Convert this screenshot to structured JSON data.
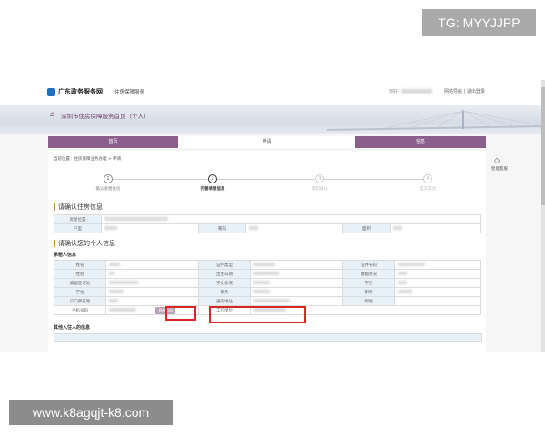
{
  "overlay": {
    "tg_label": "TG: MYYJJPP",
    "watermark_url": "www.k8agqjt-k8.com"
  },
  "portal": {
    "site_name": "广东政务服务网",
    "service_name": "住房保障服务",
    "user_prefix": "你好",
    "top_links": "网站导航 | 退出登录",
    "banner_title": "深圳市住房保障服务首页（个人）"
  },
  "nav": {
    "items": [
      {
        "label": "首页"
      },
      {
        "label": "申请"
      },
      {
        "label": "信息"
      }
    ]
  },
  "side": {
    "icon": "diamond-arrow-icon",
    "label": "智能客服"
  },
  "breadcrumb": "当前位置：住房保障业务办理 > 申请",
  "steps": [
    {
      "num": "1",
      "label": "确认承租住房"
    },
    {
      "num": "2",
      "label": "完善承租信息"
    },
    {
      "num": "3",
      "label": "资料确认"
    },
    {
      "num": "4",
      "label": "提交成功"
    }
  ],
  "housing_section": {
    "title": "请确认住房信息",
    "location_label": "房屋位置",
    "type_label": "户型",
    "area_label": "朝向",
    "size_label": "面积"
  },
  "personal_section": {
    "title": "请确认您的个人信息",
    "applicant_title": "承租人信息",
    "rows": [
      [
        "姓名",
        "",
        "证件类型",
        "",
        "证件号码",
        ""
      ],
      [
        "性别",
        "",
        "出生日期",
        "",
        "婚姻状况",
        ""
      ],
      [
        "婚姻登记地",
        "",
        "子女状况",
        "",
        "学历",
        ""
      ],
      [
        "学位",
        "",
        "职务",
        "",
        "职称",
        ""
      ],
      [
        "户口所在地",
        "",
        "通讯地址",
        "",
        "邮编",
        ""
      ]
    ],
    "phone_label": "手机号码",
    "modify_button": "修改号码",
    "employer_label": "工作单位"
  },
  "other_section": {
    "title": "其他入住人的信息"
  },
  "colors": {
    "nav_purple": "#8b5e8c",
    "highlight_red": "#d62828",
    "label_bg": "#e8f0f8"
  }
}
